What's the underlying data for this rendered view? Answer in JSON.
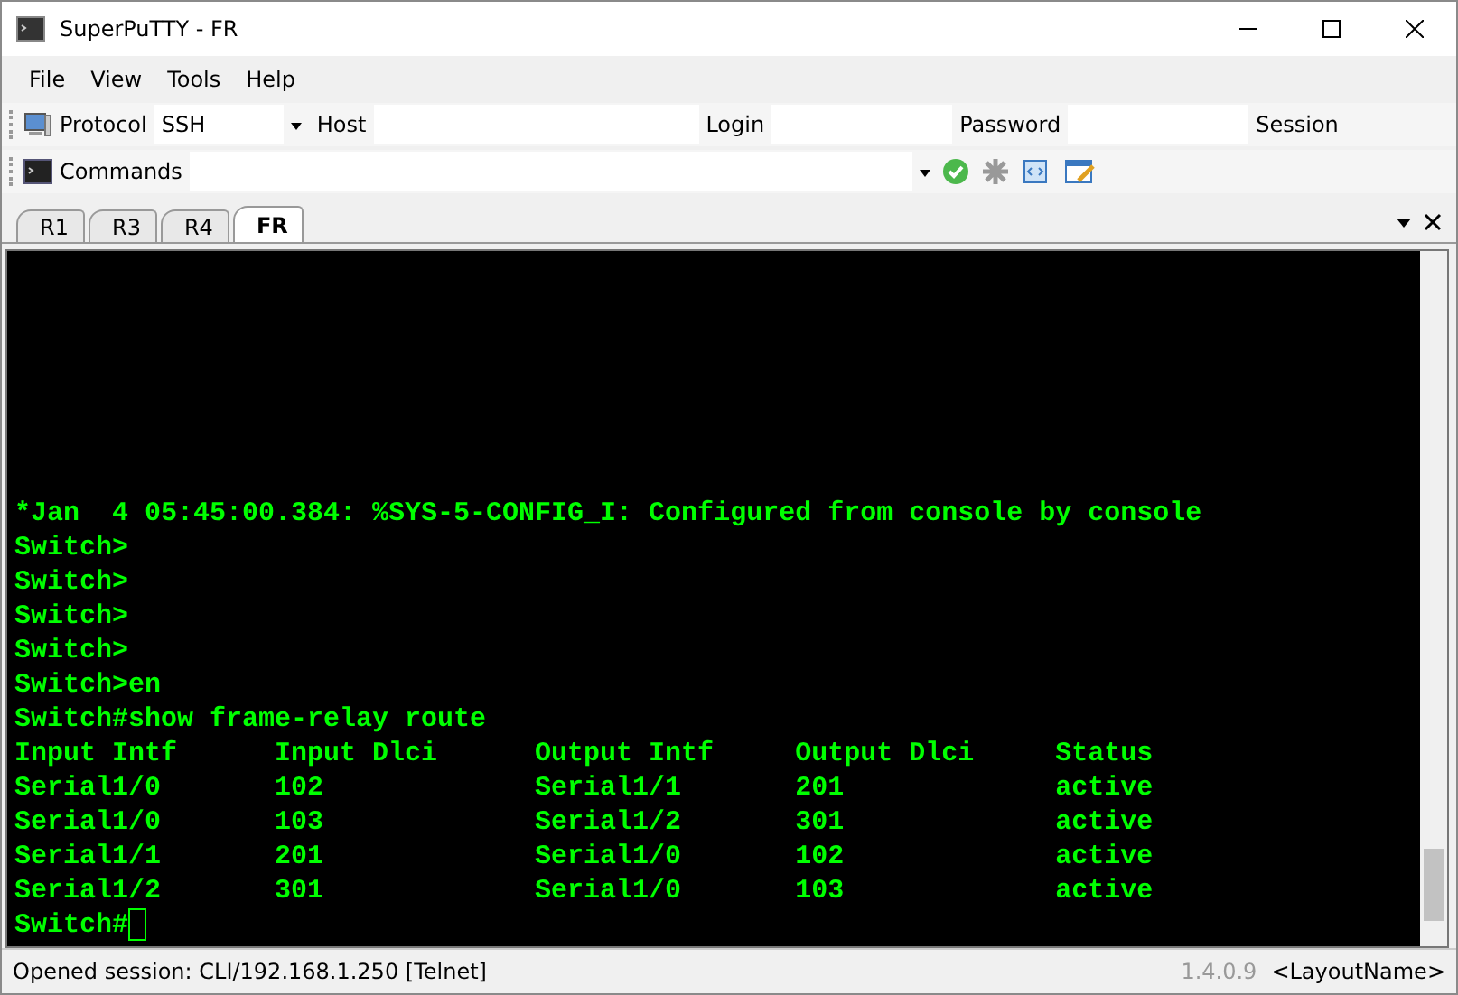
{
  "window": {
    "title": "SuperPuTTY - FR"
  },
  "menu": [
    "File",
    "View",
    "Tools",
    "Help"
  ],
  "connection_bar": {
    "protocol_label": "Protocol",
    "protocol_value": "SSH",
    "host_label": "Host",
    "login_label": "Login",
    "password_label": "Password",
    "session_label": "Session"
  },
  "commands_bar": {
    "label": "Commands"
  },
  "tabs": [
    {
      "label": "R1",
      "selected": false
    },
    {
      "label": "R3",
      "selected": false
    },
    {
      "label": "R4",
      "selected": false
    },
    {
      "label": "FR",
      "selected": true
    }
  ],
  "terminal": {
    "lines": [
      "*Jan  4 05:45:00.384: %SYS-5-CONFIG_I: Configured from console by console",
      "Switch>",
      "Switch>",
      "Switch>",
      "Switch>",
      "Switch>en",
      "Switch#show frame-relay route",
      "Input Intf      Input Dlci      Output Intf     Output Dlci     Status",
      "Serial1/0       102             Serial1/1       201             active",
      "Serial1/0       103             Serial1/2       301             active",
      "Serial1/1       201             Serial1/0       102             active",
      "Serial1/2       301             Serial1/0       103             active"
    ],
    "prompt": "Switch#"
  },
  "status_bar": {
    "message": "Opened session: CLI/192.168.1.250 [Telnet]",
    "version": "1.4.0.9",
    "layout": "<LayoutName>"
  }
}
